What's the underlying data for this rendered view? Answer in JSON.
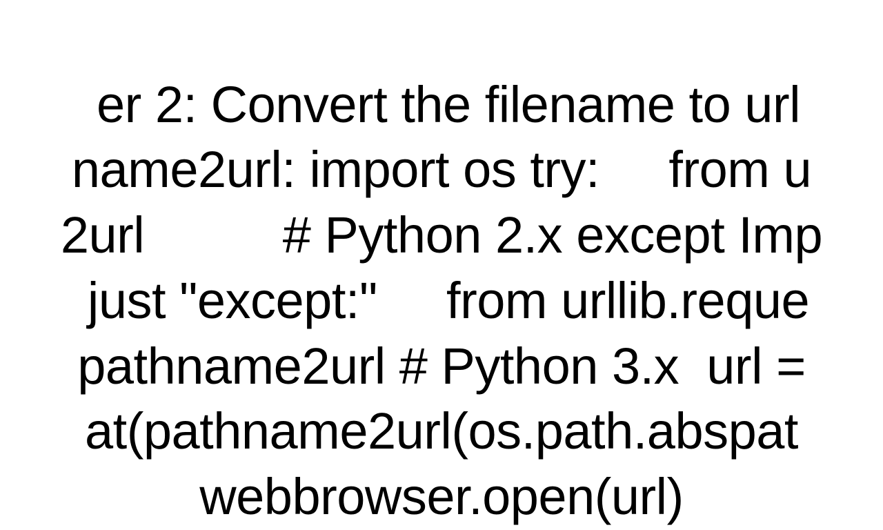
{
  "snippet": {
    "lines": [
      "er 2: Convert the filename to url ",
      "name2url: import os try:     from u",
      "2url          # Python 2.x except Imp",
      " just \"except:\"     from urllib.reque",
      "pathname2url # Python 3.x  url =",
      "at(pathname2url(os.path.abspat",
      "webbrowser.open(url)"
    ]
  }
}
